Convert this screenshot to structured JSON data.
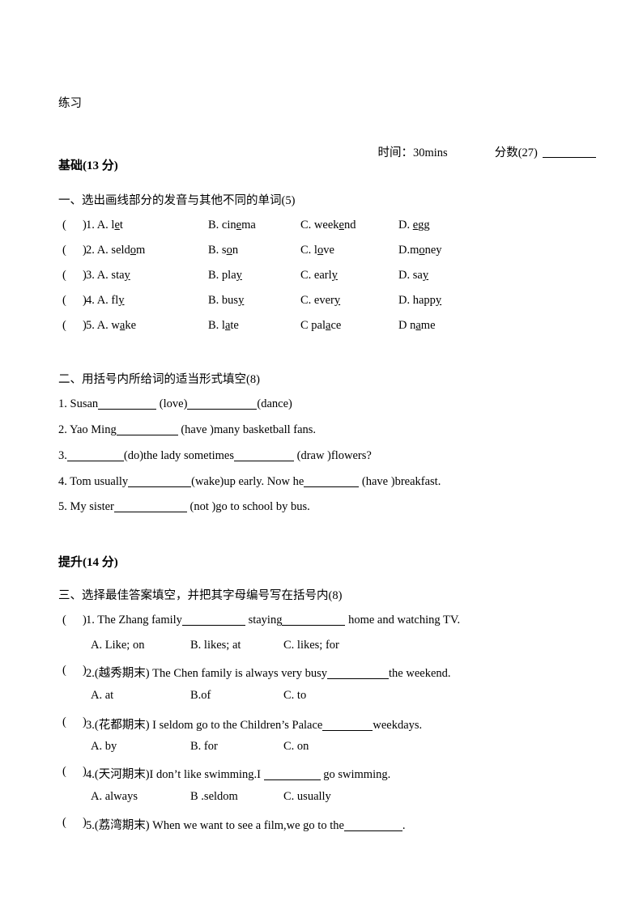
{
  "document": {
    "title": "练习",
    "meta": {
      "time_label": "时间：30mins",
      "score_label": "分数(27)"
    }
  },
  "parts": {
    "basic_heading": "基础(13 分)",
    "advanced_heading": "提升(14 分)"
  },
  "section1": {
    "heading": "一、选出画线部分的发音与其他不同的单词(5)",
    "left_paren": "(",
    "right_paren": ")",
    "rows": [
      {
        "num": "1.",
        "a": {
          "label": "A. ",
          "pre": "l",
          "mark": "e",
          "post": "t"
        },
        "b": {
          "label": "B. ",
          "pre": "cin",
          "mark": "e",
          "post": "ma"
        },
        "c": {
          "label": "C. ",
          "pre": "week",
          "mark": "e",
          "post": "nd"
        },
        "d": {
          "label": "D. ",
          "pre": "",
          "mark": "e",
          "post": "gg"
        }
      },
      {
        "num": "2.",
        "a": {
          "label": "A. ",
          "pre": "seld",
          "mark": "o",
          "post": "m"
        },
        "b": {
          "label": "B. ",
          "pre": "s",
          "mark": "o",
          "post": "n"
        },
        "c": {
          "label": "C. ",
          "pre": "l",
          "mark": "o",
          "post": "ve"
        },
        "d": {
          "label": "D.",
          "pre": "m",
          "mark": "o",
          "post": "ney"
        }
      },
      {
        "num": "3.",
        "a": {
          "label": "A. ",
          "pre": "sta",
          "mark": "y",
          "post": ""
        },
        "b": {
          "label": "B. ",
          "pre": "pla",
          "mark": "y",
          "post": ""
        },
        "c": {
          "label": "C. ",
          "pre": "earl",
          "mark": "y",
          "post": ""
        },
        "d": {
          "label": "D. ",
          "pre": "sa",
          "mark": "y",
          "post": ""
        }
      },
      {
        "num": "4.",
        "a": {
          "label": "A. ",
          "pre": "fl",
          "mark": "y",
          "post": ""
        },
        "b": {
          "label": "B. ",
          "pre": "bus",
          "mark": "y",
          "post": ""
        },
        "c": {
          "label": "C. ",
          "pre": "ever",
          "mark": "y",
          "post": ""
        },
        "d": {
          "label": "D. ",
          "pre": "happ",
          "mark": "y",
          "post": ""
        }
      },
      {
        "num": "5.",
        "a": {
          "label": "A. ",
          "pre": "w",
          "mark": "a",
          "post": "ke"
        },
        "b": {
          "label": "B. ",
          "pre": "l",
          "mark": "a",
          "post": "te"
        },
        "c": {
          "label": "C ",
          "pre": "pal",
          "mark": "a",
          "post": "ce"
        },
        "d": {
          "label": "D ",
          "pre": "n",
          "mark": "a",
          "post": "me"
        }
      }
    ]
  },
  "section2": {
    "heading": "二、用括号内所给词的适当形式填空(8)",
    "items": [
      {
        "segments": [
          {
            "text": "1. Susan"
          },
          {
            "blank": 72
          },
          {
            "text": " (love)"
          },
          {
            "blank": 86
          },
          {
            "text": "(dance)"
          }
        ]
      },
      {
        "segments": [
          {
            "text": "2. Yao Ming"
          },
          {
            "blank": 76
          },
          {
            "text": " (have )many basketball fans."
          }
        ]
      },
      {
        "segments": [
          {
            "text": "3."
          },
          {
            "blank": 70
          },
          {
            "text": "(do)the lady sometimes"
          },
          {
            "blank": 74
          },
          {
            "text": " (draw )flowers?"
          }
        ]
      },
      {
        "segments": [
          {
            "text": "4. Tom usually"
          },
          {
            "blank": 78
          },
          {
            "text": "(wake)up early. Now he"
          },
          {
            "blank": 68
          },
          {
            "text": " (have )breakfast."
          }
        ]
      },
      {
        "segments": [
          {
            "text": "5. My sister"
          },
          {
            "blank": 90
          },
          {
            "text": " (not )go to school by bus."
          }
        ]
      }
    ]
  },
  "section3": {
    "heading": "三、选择最佳答案填空，并把其字母编号写在括号内(8)",
    "left_paren": "(",
    "right_paren": ")",
    "questions": [
      {
        "num": "1.",
        "segments": [
          {
            "text": "1. The Zhang family"
          },
          {
            "blank": 78
          },
          {
            "text": " staying"
          },
          {
            "blank": 78
          },
          {
            "text": " home and watching TV."
          }
        ],
        "options": {
          "a": "A. Like; on",
          "b": "B. likes; at",
          "c": "C. likes; for"
        }
      },
      {
        "num": "2.",
        "segments": [
          {
            "text": "2.(越秀期末) The Chen family is always very busy"
          },
          {
            "blank": 76
          },
          {
            "text": "the weekend."
          }
        ],
        "options": {
          "a": "A. at",
          "b": "B.of",
          "c": "C. to"
        }
      },
      {
        "num": "3.",
        "segments": [
          {
            "text": "3.(花都期末) I seldom go to the Children’s Palace"
          },
          {
            "blank": 62
          },
          {
            "text": "weekdays."
          }
        ],
        "options": {
          "a": "A. by",
          "b": "B. for",
          "c": "C. on"
        }
      },
      {
        "num": "4.",
        "segments": [
          {
            "text": "4.(天河期末)I don’t like swimming.I "
          },
          {
            "blank": 70
          },
          {
            "text": " go swimming."
          }
        ],
        "options": {
          "a": "A. always",
          "b": "B .seldom",
          "c": "C. usually"
        }
      },
      {
        "num": "5.",
        "segments": [
          {
            "text": "5.(荔湾期末) When we want to see a film,we go to the"
          },
          {
            "blank": 72
          },
          {
            "text": "."
          }
        ],
        "options": null
      }
    ]
  }
}
